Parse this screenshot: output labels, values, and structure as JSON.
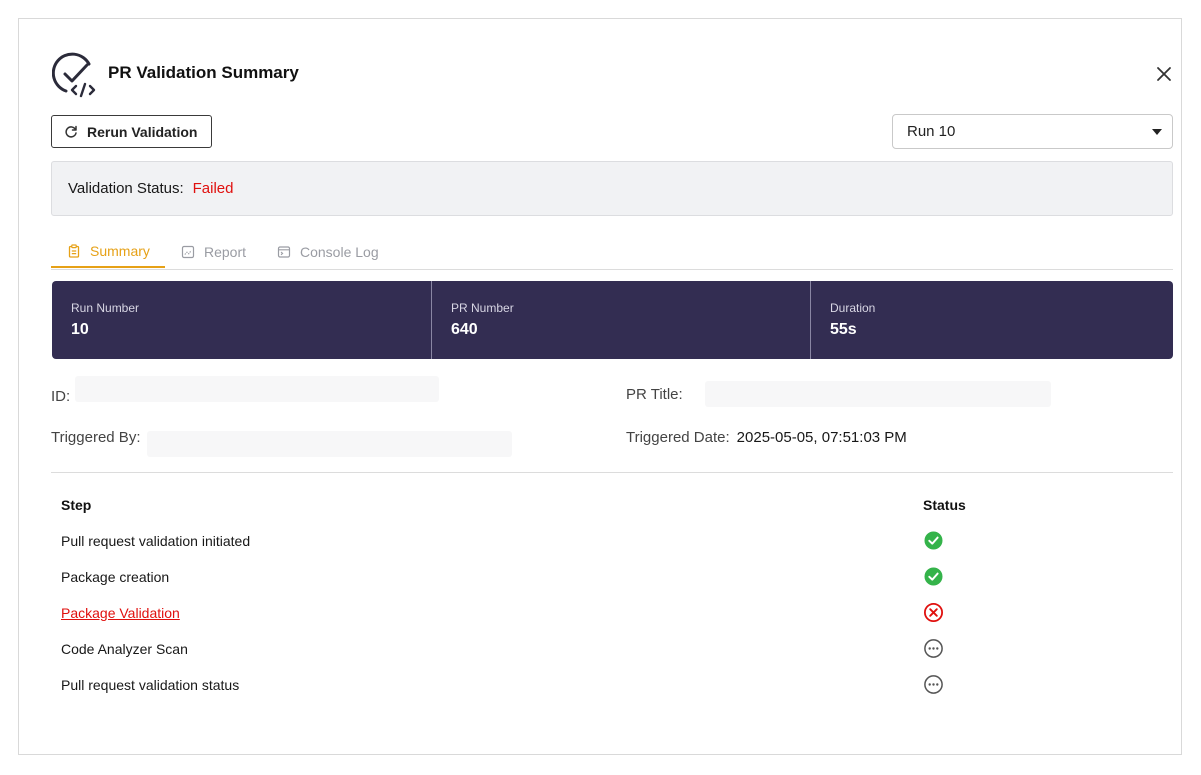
{
  "header": {
    "title": "PR Validation Summary"
  },
  "toolbar": {
    "rerun_label": "Rerun Validation",
    "run_select_value": "Run 10"
  },
  "status": {
    "label": "Validation Status:",
    "value": "Failed"
  },
  "tabs": [
    {
      "label": "Summary",
      "active": true
    },
    {
      "label": "Report",
      "active": false
    },
    {
      "label": "Console Log",
      "active": false
    }
  ],
  "metrics": [
    {
      "label": "Run Number",
      "value": "10"
    },
    {
      "label": "PR Number",
      "value": "640"
    },
    {
      "label": "Duration",
      "value": "55s"
    }
  ],
  "info": {
    "id_label": "ID:",
    "pr_title_label": "PR Title:",
    "triggered_by_label": "Triggered By:",
    "triggered_date_label": "Triggered Date:",
    "triggered_date_value": "2025-05-05, 07:51:03 PM"
  },
  "steps_table": {
    "headers": {
      "step": "Step",
      "status": "Status"
    },
    "rows": [
      {
        "step": "Pull request validation initiated",
        "status": "success"
      },
      {
        "step": "Package creation",
        "status": "success"
      },
      {
        "step": "Package Validation",
        "status": "failed"
      },
      {
        "step": "Code Analyzer Scan",
        "status": "pending"
      },
      {
        "step": "Pull request validation status",
        "status": "pending"
      }
    ]
  },
  "colors": {
    "accent": "#e6a117",
    "failed": "#e0100e",
    "success": "#34b34a",
    "metrics_bg": "#332d52",
    "pending": "#555555"
  }
}
